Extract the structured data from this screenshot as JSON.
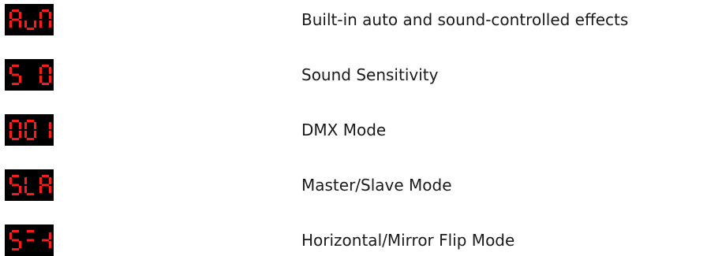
{
  "colors": {
    "display_background": "#000000",
    "segment_on": "#ff1a1a",
    "text": "#1a1a1a"
  },
  "modes": [
    {
      "display_code": [
        "A",
        "u",
        "N"
      ],
      "description": "Built-in auto and sound-controlled effects"
    },
    {
      "display_code": [
        "S",
        " ",
        "0"
      ],
      "description": "Sound Sensitivity"
    },
    {
      "display_code": [
        "0",
        "0",
        "1"
      ],
      "description": "DMX Mode"
    },
    {
      "display_code": [
        "S",
        "L",
        "A"
      ],
      "description": "Master/Slave Mode"
    },
    {
      "display_code": [
        "S",
        "=",
        "-1"
      ],
      "description": "Horizontal/Mirror Flip Mode"
    }
  ]
}
